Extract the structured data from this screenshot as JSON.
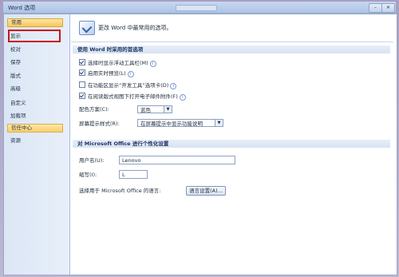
{
  "window": {
    "title": "Word 选项",
    "minimize_symbol": "–",
    "close_symbol": "✕"
  },
  "sidebar": {
    "items": [
      {
        "label": "常用"
      },
      {
        "label": "显示"
      },
      {
        "label": "校对"
      },
      {
        "label": "保存"
      },
      {
        "label": "版式"
      },
      {
        "label": "高级"
      },
      {
        "label": "自定义"
      },
      {
        "label": "加载项"
      },
      {
        "label": "信任中心"
      },
      {
        "label": "资源"
      }
    ]
  },
  "main": {
    "top_caption": "更改 Word 中最常用的选项。",
    "section1": {
      "title": "使用 Word 时采用的首选项",
      "options": [
        {
          "label": "选择时显示浮动工具栏(M)",
          "checked": true
        },
        {
          "label": "启用实时预览(L)",
          "checked": true
        },
        {
          "label": "在功能区显示“开发工具”选项卡(D)",
          "checked": false
        },
        {
          "label": "在阅读版式视图下打开电子邮件附件(F)",
          "checked": true
        }
      ],
      "info_symbol": "i",
      "color_scheme_label": "配色方案(C):",
      "color_scheme_value": "蓝色",
      "screentip_label": "屏幕提示样式(R):",
      "screentip_value": "在屏幕提示中显示功能说明",
      "dropdown_symbol": "▼"
    },
    "section2": {
      "title": "对 Microsoft Office 进行个性化设置",
      "username_label": "用户名(U):",
      "username_value": "Lenovo",
      "initials_label": "缩写(I):",
      "initials_value": "L",
      "language_label": "选择用于 Microsoft Office 的语言:",
      "language_button": "语言设置(A)..."
    }
  }
}
